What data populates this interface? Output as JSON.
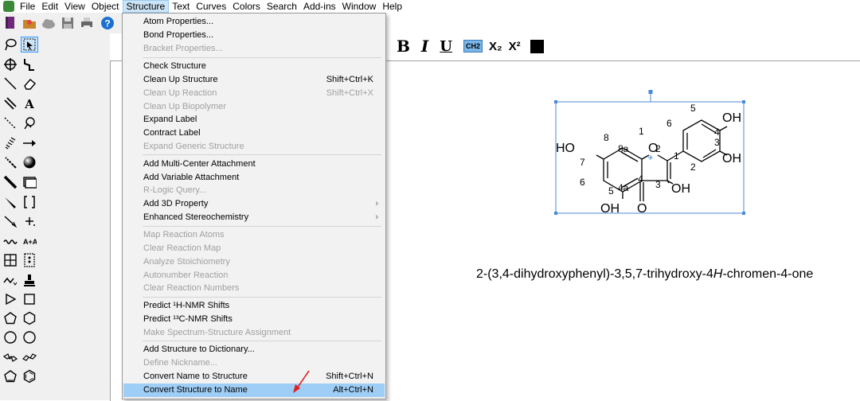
{
  "menubar": {
    "items": [
      "File",
      "Edit",
      "View",
      "Object",
      "Structure",
      "Text",
      "Curves",
      "Colors",
      "Search",
      "Add-ins",
      "Window",
      "Help"
    ],
    "open_item": "Structure"
  },
  "texttools": {
    "bold": "B",
    "italic": "I",
    "underline": "U",
    "formula": "CH2",
    "subscript": "X₂",
    "superscript": "X²"
  },
  "structure_menu": {
    "items": [
      {
        "label": "Atom Properties...",
        "enabled": true
      },
      {
        "label": "Bond Properties...",
        "enabled": true
      },
      {
        "label": "Bracket Properties...",
        "enabled": false
      },
      {
        "label": "Check Structure",
        "enabled": true
      },
      {
        "label": "Clean Up Structure",
        "shortcut": "Shift+Ctrl+K",
        "enabled": true
      },
      {
        "label": "Clean Up Reaction",
        "shortcut": "Shift+Ctrl+X",
        "enabled": false
      },
      {
        "label": "Clean Up Biopolymer",
        "enabled": false
      },
      {
        "label": "Expand Label",
        "enabled": true
      },
      {
        "label": "Contract Label",
        "enabled": true
      },
      {
        "label": "Expand Generic Structure",
        "enabled": false
      },
      {
        "label": "Add Multi-Center Attachment",
        "enabled": true
      },
      {
        "label": "Add Variable Attachment",
        "enabled": true
      },
      {
        "label": "R-Logic Query...",
        "enabled": false
      },
      {
        "label": "Add 3D Property",
        "enabled": true,
        "submenu": true
      },
      {
        "label": "Enhanced Stereochemistry",
        "enabled": true,
        "submenu": true
      },
      {
        "label": "Map Reaction Atoms",
        "enabled": false
      },
      {
        "label": "Clear Reaction Map",
        "enabled": false
      },
      {
        "label": "Analyze Stoichiometry",
        "enabled": false
      },
      {
        "label": "Autonumber Reaction",
        "enabled": false
      },
      {
        "label": "Clear Reaction Numbers",
        "enabled": false
      },
      {
        "label": "Predict ¹H-NMR Shifts",
        "enabled": true
      },
      {
        "label": "Predict ¹³C-NMR Shifts",
        "enabled": true
      },
      {
        "label": "Make Spectrum-Structure Assignment",
        "enabled": false
      },
      {
        "label": "Add Structure to Dictionary...",
        "enabled": true
      },
      {
        "label": "Define Nickname...",
        "enabled": false
      },
      {
        "label": "Convert Name to Structure",
        "shortcut": "Shift+Ctrl+N",
        "enabled": true
      },
      {
        "label": "Convert Structure to Name",
        "shortcut": "Alt+Ctrl+N",
        "enabled": true,
        "highlighted": true
      }
    ]
  },
  "molecule": {
    "atom_labels": {
      "ho_left": "HO",
      "o_ring": "O",
      "oh_c3": "OH",
      "o_carbonyl": "O",
      "oh_c5": "OH",
      "oh_c4p": "OH",
      "oh_c3p": "OH"
    },
    "locants": {
      "n1": "1",
      "n2": "2",
      "n3": "3",
      "n4": "4",
      "n4a": "4a",
      "n5": "5",
      "n6": "6",
      "n7": "7",
      "n8": "8",
      "n8a": "8a",
      "p1": "1",
      "p2": "2",
      "p3": "3",
      "p4": "4",
      "p5": "5",
      "p6": "6"
    }
  },
  "iupac_name": {
    "prefix": "2-(3,4-dihydroxyphenyl)-3,5,7-trihydroxy-4",
    "italic": "H",
    "suffix": "-chromen-4-one"
  },
  "colors": {
    "menu_highlight": "#9ecdf5",
    "open_menu": "#cce4f7",
    "selection_box": "#4a8ad4"
  }
}
